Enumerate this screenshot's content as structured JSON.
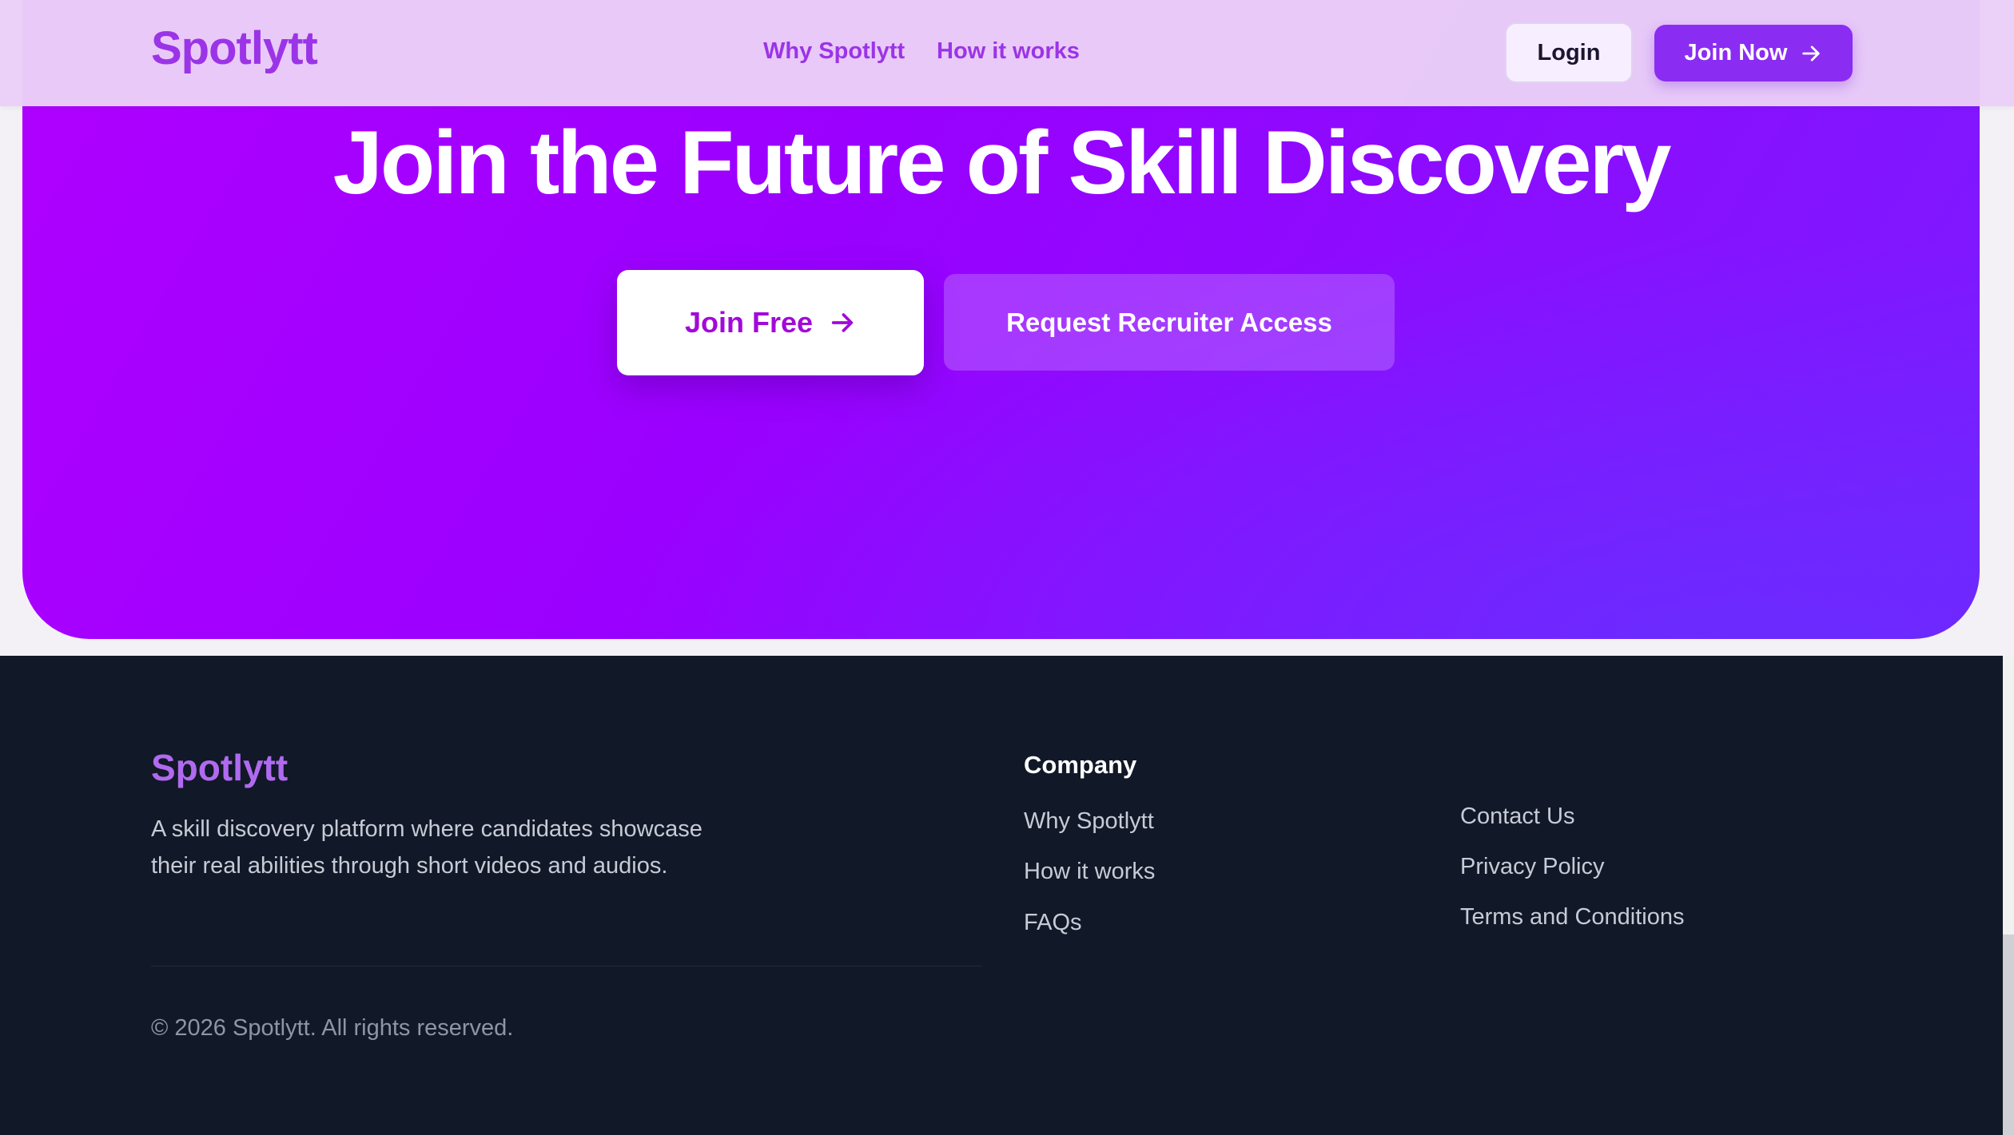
{
  "nav": {
    "logo": "Spotlytt",
    "links": [
      "Why Spotlytt",
      "How it works"
    ],
    "login_label": "Login",
    "join_now_label": "Join Now"
  },
  "hero": {
    "title": "Join the Future of Skill Discovery",
    "join_free_label": "Join Free",
    "recruiter_label": "Request Recruiter Access"
  },
  "footer": {
    "logo": "Spotlytt",
    "description": "A skill discovery platform where candidates showcase their real abilities through short videos and audios.",
    "company_heading": "Company",
    "company_links": [
      "Why Spotlytt",
      "How it works",
      "FAQs"
    ],
    "legal_links": [
      "Contact Us",
      "Privacy Policy",
      "Terms and Conditions"
    ],
    "copyright": "© 2026 Spotlytt. All rights reserved."
  },
  "colors": {
    "brand": "#9b34e6",
    "hero_gradient_start": "#b000ff",
    "hero_gradient_end": "#7a1cff",
    "footer_bg": "#111827"
  }
}
